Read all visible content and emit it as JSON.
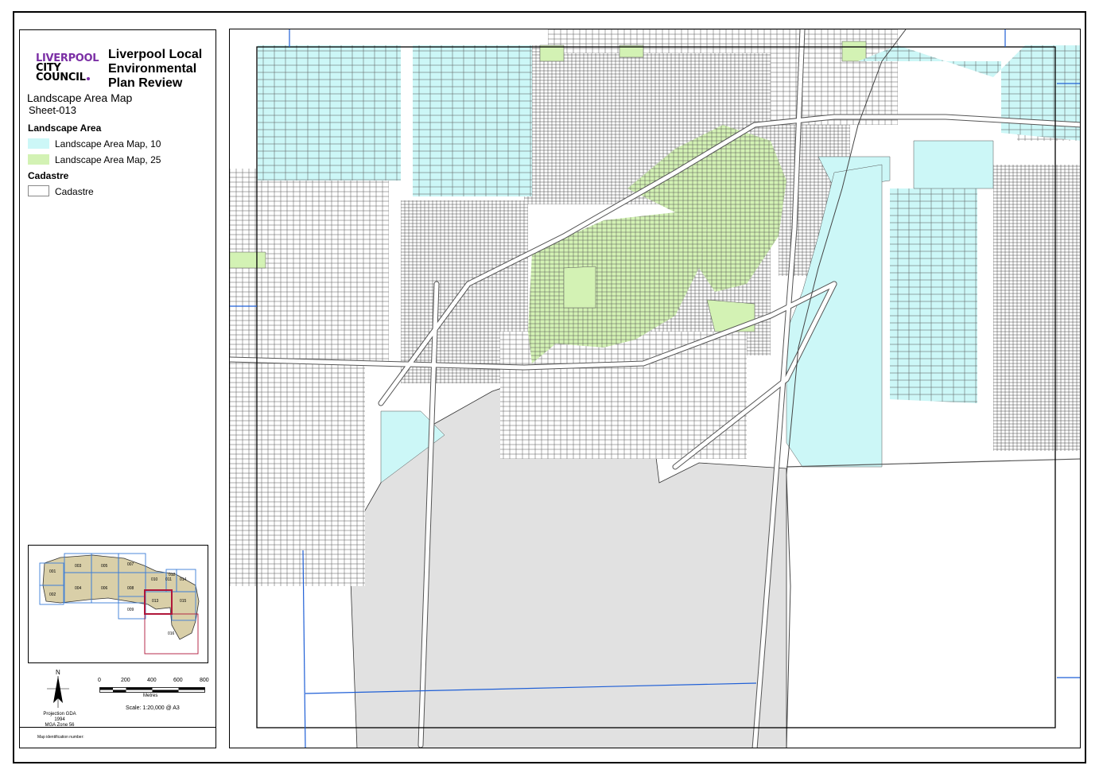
{
  "header": {
    "logo_line1": "LIVERPOOL",
    "logo_line2": "CITY",
    "logo_line3": "COUNCIL",
    "title": "Liverpool Local Environmental Plan Review",
    "subtitle": "Landscape Area Map",
    "sheet": "Sheet-013"
  },
  "legend": {
    "landscape_heading": "Landscape Area",
    "items": [
      {
        "label": "Landscape Area Map, 10",
        "color": "#ccf7f7"
      },
      {
        "label": "Landscape Area Map, 25",
        "color": "#d3f2b4"
      }
    ],
    "cadastre_heading": "Cadastre",
    "cadastre_label": "Cadastre"
  },
  "inset": {
    "sheets": [
      "001",
      "002",
      "003",
      "004",
      "005",
      "006",
      "007",
      "008",
      "009",
      "010",
      "011",
      "012",
      "013",
      "014",
      "015",
      "016"
    ],
    "highlight": "013"
  },
  "north_label": "N",
  "scale": {
    "ticks": [
      "0",
      "200",
      "400",
      "600",
      "800"
    ],
    "unit": "Metres",
    "text": "Scale: 1:20,000 @ A3"
  },
  "projection": {
    "line1": "Projection GDA 1994",
    "line2": "MGA Zone 56"
  },
  "id_label": "Map identification number:",
  "colors": {
    "landscape_10": "#ccf7f7",
    "landscape_25": "#d3f2b4",
    "excluded": "#e1e1e1",
    "sheet_frame": "#000000",
    "grid_lines": "#1f5fd6",
    "inset_highlight": "#b0173a"
  }
}
